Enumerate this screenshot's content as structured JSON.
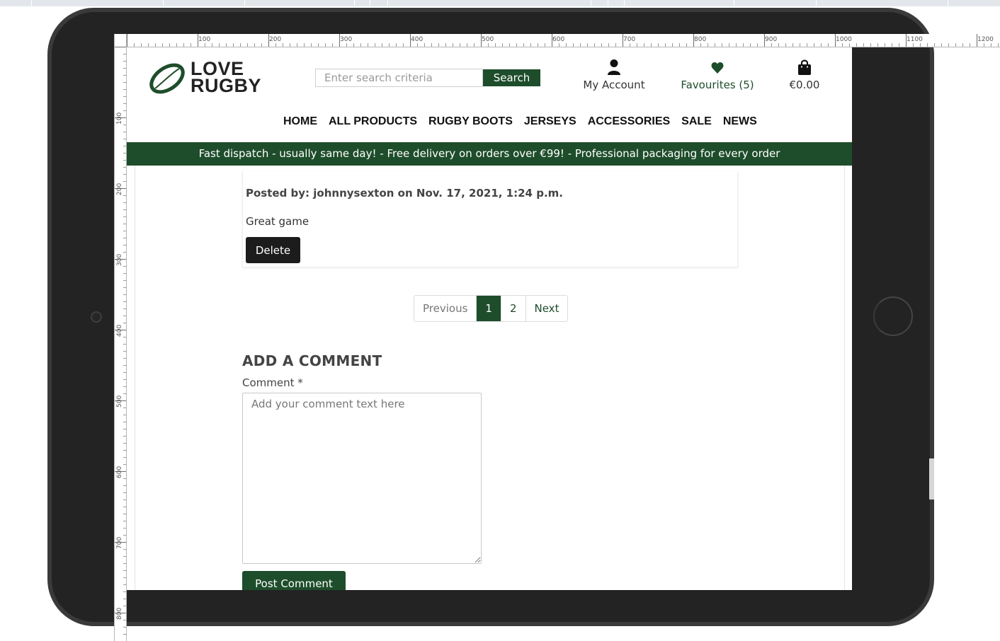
{
  "ruler": {
    "top_labels": [
      "100",
      "200",
      "300",
      "400",
      "500",
      "600",
      "700",
      "800",
      "900",
      "1000",
      "1100",
      "1200"
    ],
    "left_labels": [
      "100",
      "200",
      "300",
      "400",
      "500",
      "600",
      "700",
      "800"
    ]
  },
  "brand": {
    "logo_line1": "LOVE",
    "logo_line2": "RUGBY",
    "accent_color": "#1e4d2b"
  },
  "search": {
    "placeholder": "Enter search criteria",
    "button_label": "Search"
  },
  "header": {
    "account_label": "My Account",
    "account_icon": "user-icon",
    "favourites_label": "Favourites (5)",
    "favourites_icon": "heart-icon",
    "bag_label": "€0.00",
    "bag_icon": "shopping-bag-icon"
  },
  "nav": {
    "items": [
      "HOME",
      "ALL PRODUCTS",
      "RUGBY BOOTS",
      "JERSEYS",
      "ACCESSORIES",
      "SALE",
      "NEWS"
    ]
  },
  "banner": {
    "text": "Fast dispatch - usually same day! - Free delivery on orders over €99! - Professional packaging for every order"
  },
  "comment": {
    "posted_by": "Posted by: johnnysexton on Nov. 17, 2021, 1:24 p.m.",
    "body": "Great game",
    "delete_label": "Delete"
  },
  "pagination": {
    "previous": "Previous",
    "pages": [
      "1",
      "2"
    ],
    "active_page": "1",
    "next": "Next"
  },
  "form": {
    "title": "ADD A COMMENT",
    "comment_label": "Comment *",
    "comment_placeholder": "Add your comment text here",
    "submit_label": "Post Comment"
  }
}
